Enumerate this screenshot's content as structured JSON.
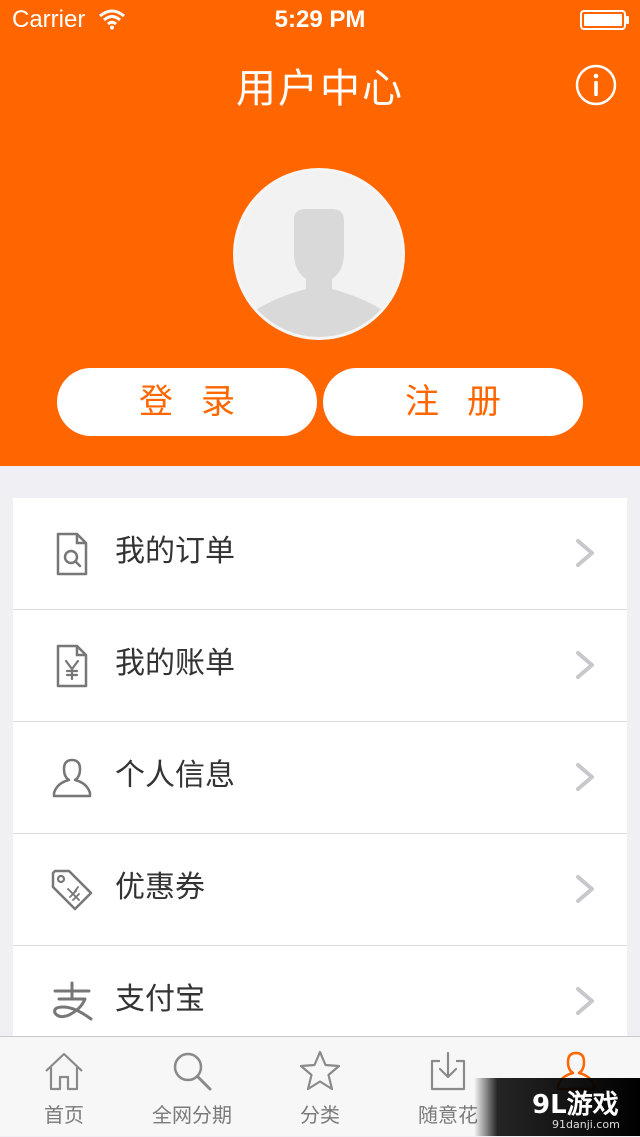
{
  "status_bar": {
    "carrier": "Carrier",
    "time": "5:29 PM"
  },
  "nav": {
    "title": "用户中心",
    "info_icon": "info-circle-icon"
  },
  "profile": {
    "avatar_icon": "default-avatar-icon",
    "login_label": "登录",
    "register_label": "注册"
  },
  "menu": {
    "items": [
      {
        "label": "我的订单",
        "icon": "order-search-icon"
      },
      {
        "label": "我的账单",
        "icon": "bill-yen-icon"
      },
      {
        "label": "个人信息",
        "icon": "user-outline-icon"
      },
      {
        "label": "优惠券",
        "icon": "coupon-tag-icon"
      },
      {
        "label": "支付宝",
        "icon": "alipay-icon"
      }
    ]
  },
  "tab_bar": {
    "tabs": [
      {
        "label": "首页",
        "icon": "home-icon"
      },
      {
        "label": "全网分期",
        "icon": "search-icon"
      },
      {
        "label": "分类",
        "icon": "star-icon"
      },
      {
        "label": "随意花",
        "icon": "download-tray-icon"
      },
      {
        "label": "",
        "icon": "user-icon",
        "active": true
      }
    ]
  },
  "watermark": {
    "main": "9L游戏",
    "sub": "91danji.com"
  },
  "colors": {
    "accent": "#ff6600",
    "background": "#efeff4",
    "text": "#333333",
    "tab_inactive": "#7a7a7a"
  }
}
